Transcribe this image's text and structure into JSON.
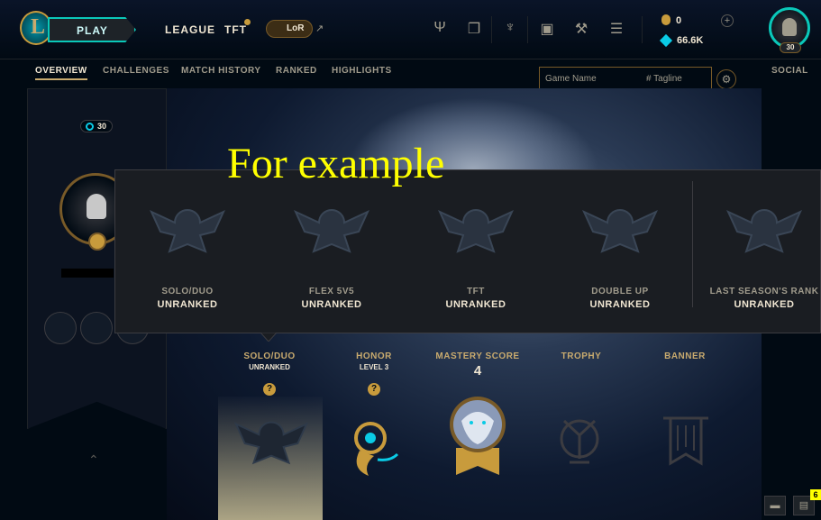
{
  "topbar": {
    "play_label": "PLAY",
    "nav": [
      "LEAGUE",
      "TFT"
    ],
    "lor_label": "LoR",
    "lor_external": "↗",
    "icons": [
      "trident-icon",
      "cards-icon",
      "crest-icon",
      "chest-icon",
      "hammer-icon",
      "loot-icon"
    ],
    "currency": {
      "rp": "0",
      "be": "66.6K",
      "plus": "+"
    },
    "level": "30"
  },
  "subnav": {
    "tabs": [
      "OVERVIEW",
      "CHALLENGES",
      "MATCH HISTORY",
      "RANKED",
      "HIGHLIGHTS"
    ],
    "active": "OVERVIEW",
    "search": {
      "name_placeholder": "Game Name",
      "tag_placeholder": "# Tagline"
    },
    "social": "SOCIAL"
  },
  "profile": {
    "level": "30"
  },
  "overlay": {
    "caption": "For example"
  },
  "ranked_popup": {
    "queues": [
      {
        "name": "SOLO/DUO",
        "value": "UNRANKED"
      },
      {
        "name": "FLEX 5V5",
        "value": "UNRANKED"
      },
      {
        "name": "TFT",
        "value": "UNRANKED"
      },
      {
        "name": "DOUBLE UP",
        "value": "UNRANKED"
      },
      {
        "name": "LAST SEASON'S RANK",
        "value": "UNRANKED"
      }
    ]
  },
  "trophy_row": {
    "solo": {
      "label": "SOLO/DUO",
      "sub": "UNRANKED",
      "help": "?"
    },
    "honor": {
      "label": "HONOR",
      "sub": "LEVEL 3",
      "help": "?"
    },
    "mastery": {
      "label": "MASTERY SCORE",
      "value": "4"
    },
    "trophy": {
      "label": "TROPHY"
    },
    "banner": {
      "label": "BANNER"
    }
  },
  "footer": {
    "notifications": "6"
  },
  "colors": {
    "gold": "#c8aa6e",
    "teal": "#0ac8b9",
    "bg": "#010a13",
    "highlight_text": "#ffff00"
  }
}
